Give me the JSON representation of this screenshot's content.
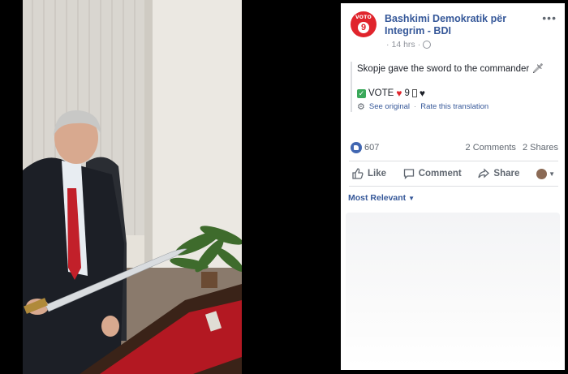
{
  "post": {
    "page_name": "Bashkimi Demokratik për Integrim - BDI",
    "logo": {
      "top_text": "VOTO",
      "number": "9",
      "color": "#e0242c"
    },
    "time": "14 hrs",
    "more_icon": "more-dots-icon",
    "message": "Skopje gave the sword to the commander",
    "vote_line": {
      "text": "VOTE",
      "number": "9"
    },
    "see_original": "See original",
    "rate_translation": "Rate this translation",
    "reactions_count": "607",
    "comments_count": "2 Comments",
    "shares_count": "2 Shares",
    "actions": {
      "like": "Like",
      "comment": "Comment",
      "share": "Share"
    },
    "sort_label": "Most Relevant",
    "link_color": "#365899"
  }
}
